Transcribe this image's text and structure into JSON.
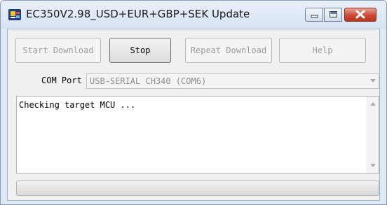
{
  "window": {
    "title": "EC350V2.98_USD+EUR+GBP+SEK Update",
    "icon": "app-chip-icon"
  },
  "title_controls": {
    "minimize_icon": "minimize-icon",
    "maximize_icon": "maximize-icon",
    "close_icon": "close-icon",
    "close_color": "#c8442f"
  },
  "toolbar": {
    "start_download_label": "Start Download",
    "stop_label": "Stop",
    "repeat_download_label": "Repeat Download",
    "help_label": "Help"
  },
  "com_port": {
    "label": "COM Port",
    "selected": "USB-SERIAL CH340 (COM6)"
  },
  "log": {
    "text": "Checking target MCU ..."
  },
  "progress": {
    "value_percent": 0,
    "fill_color": "#37b21f"
  }
}
